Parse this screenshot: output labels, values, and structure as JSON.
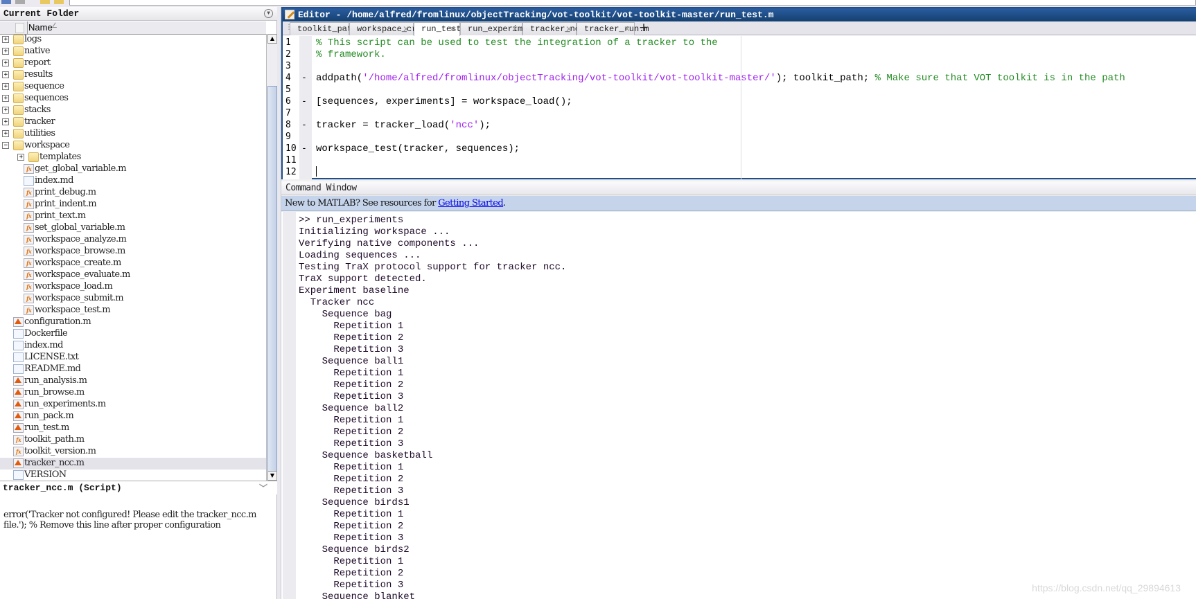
{
  "current_folder": {
    "title": "Current Folder",
    "column_name": "Name",
    "sort_indicator": "∠",
    "items": [
      {
        "name": "logs",
        "type": "folder",
        "level": 0,
        "expand": "+"
      },
      {
        "name": "native",
        "type": "folder",
        "level": 0,
        "expand": "+"
      },
      {
        "name": "report",
        "type": "folder",
        "level": 0,
        "expand": "+"
      },
      {
        "name": "results",
        "type": "folder",
        "level": 0,
        "expand": "+"
      },
      {
        "name": "sequence",
        "type": "folder",
        "level": 0,
        "expand": "+"
      },
      {
        "name": "sequences",
        "type": "folder",
        "level": 0,
        "expand": "+"
      },
      {
        "name": "stacks",
        "type": "folder",
        "level": 0,
        "expand": "+"
      },
      {
        "name": "tracker",
        "type": "folder",
        "level": 0,
        "expand": "+"
      },
      {
        "name": "utilities",
        "type": "folder",
        "level": 0,
        "expand": "+"
      },
      {
        "name": "workspace",
        "type": "folder",
        "level": 0,
        "expand": "−"
      },
      {
        "name": "templates",
        "type": "folder",
        "level": 1,
        "expand": "+"
      },
      {
        "name": "get_global_variable.m",
        "type": "function",
        "level": 1
      },
      {
        "name": "index.md",
        "type": "doc",
        "level": 1
      },
      {
        "name": "print_debug.m",
        "type": "function",
        "level": 1
      },
      {
        "name": "print_indent.m",
        "type": "function",
        "level": 1
      },
      {
        "name": "print_text.m",
        "type": "function",
        "level": 1
      },
      {
        "name": "set_global_variable.m",
        "type": "function",
        "level": 1
      },
      {
        "name": "workspace_analyze.m",
        "type": "function",
        "level": 1
      },
      {
        "name": "workspace_browse.m",
        "type": "function",
        "level": 1
      },
      {
        "name": "workspace_create.m",
        "type": "function",
        "level": 1
      },
      {
        "name": "workspace_evaluate.m",
        "type": "function",
        "level": 1
      },
      {
        "name": "workspace_load.m",
        "type": "function",
        "level": 1
      },
      {
        "name": "workspace_submit.m",
        "type": "function",
        "level": 1
      },
      {
        "name": "workspace_test.m",
        "type": "function",
        "level": 1
      },
      {
        "name": "configuration.m",
        "type": "script",
        "level": 0
      },
      {
        "name": "Dockerfile",
        "type": "doc",
        "level": 0
      },
      {
        "name": "index.md",
        "type": "doc",
        "level": 0
      },
      {
        "name": "LICENSE.txt",
        "type": "doc",
        "level": 0
      },
      {
        "name": "README.md",
        "type": "doc",
        "level": 0
      },
      {
        "name": "run_analysis.m",
        "type": "script",
        "level": 0
      },
      {
        "name": "run_browse.m",
        "type": "script",
        "level": 0
      },
      {
        "name": "run_experiments.m",
        "type": "script",
        "level": 0
      },
      {
        "name": "run_pack.m",
        "type": "script",
        "level": 0
      },
      {
        "name": "run_test.m",
        "type": "script",
        "level": 0
      },
      {
        "name": "toolkit_path.m",
        "type": "function",
        "level": 0
      },
      {
        "name": "toolkit_version.m",
        "type": "function",
        "level": 0
      },
      {
        "name": "tracker_ncc.m",
        "type": "script",
        "level": 0,
        "selected": true
      },
      {
        "name": "VERSION",
        "type": "doc",
        "level": 0
      }
    ]
  },
  "details": {
    "title": "tracker_ncc.m  (Script)",
    "content": "error('Tracker not configured! Please edit the tracker_ncc.m\nfile.'); % Remove this line after proper configuration"
  },
  "editor": {
    "title": "Editor - /home/alfred/fromlinux/objectTracking/vot-toolkit/vot-toolkit-master/run_test.m",
    "tabs": [
      {
        "label": "toolkit_path.m"
      },
      {
        "label": "workspace_create.m"
      },
      {
        "label": "run_test.m",
        "active": true
      },
      {
        "label": "run_experiments.m"
      },
      {
        "label": "tracker_ncc.m"
      },
      {
        "label": "tracker_run.m"
      }
    ],
    "new_tab_label": "+",
    "lines": [
      {
        "n": "1",
        "exec": false,
        "parts": [
          {
            "t": "% This script can be used to test the integration of a tracker to the",
            "c": "cm"
          }
        ]
      },
      {
        "n": "2",
        "exec": false,
        "parts": [
          {
            "t": "% framework.",
            "c": "cm"
          }
        ]
      },
      {
        "n": "3",
        "exec": false,
        "parts": []
      },
      {
        "n": "4",
        "exec": true,
        "parts": [
          {
            "t": "addpath(",
            "c": ""
          },
          {
            "t": "'/home/alfred/fromlinux/objectTracking/vot-toolkit/vot-toolkit-master/'",
            "c": "str"
          },
          {
            "t": "); toolkit_path; ",
            "c": ""
          },
          {
            "t": "% Make sure that VOT toolkit is in the path",
            "c": "cm"
          }
        ]
      },
      {
        "n": "5",
        "exec": false,
        "parts": []
      },
      {
        "n": "6",
        "exec": true,
        "parts": [
          {
            "t": "[sequences, experiments] = workspace_load();",
            "c": ""
          }
        ]
      },
      {
        "n": "7",
        "exec": false,
        "parts": []
      },
      {
        "n": "8",
        "exec": true,
        "parts": [
          {
            "t": "tracker = tracker_load(",
            "c": ""
          },
          {
            "t": "'ncc'",
            "c": "str"
          },
          {
            "t": ");",
            "c": ""
          }
        ]
      },
      {
        "n": "9",
        "exec": false,
        "parts": []
      },
      {
        "n": "10",
        "exec": true,
        "parts": [
          {
            "t": "workspace_test(tracker, sequences);",
            "c": ""
          }
        ]
      },
      {
        "n": "11",
        "exec": false,
        "parts": []
      },
      {
        "n": "12",
        "exec": false,
        "parts": []
      }
    ]
  },
  "command_window": {
    "title": "Command Window",
    "banner_prefix": "New to MATLAB? See resources for ",
    "banner_link": "Getting Started",
    "banner_suffix": ".",
    "output": [
      ">> run_experiments",
      "Initializing workspace ...",
      "Verifying native components ...",
      "Loading sequences ...",
      "Testing TraX protocol support for tracker ncc.",
      "TraX support detected.",
      "Experiment baseline",
      "  Tracker ncc",
      "    Sequence bag",
      "      Repetition 1",
      "      Repetition 2",
      "      Repetition 3",
      "    Sequence ball1",
      "      Repetition 1",
      "      Repetition 2",
      "      Repetition 3",
      "    Sequence ball2",
      "      Repetition 1",
      "      Repetition 2",
      "      Repetition 3",
      "    Sequence basketball",
      "      Repetition 1",
      "      Repetition 2",
      "      Repetition 3",
      "    Sequence birds1",
      "      Repetition 1",
      "      Repetition 2",
      "      Repetition 3",
      "    Sequence birds2",
      "      Repetition 1",
      "      Repetition 2",
      "      Repetition 3",
      "    Sequence blanket"
    ]
  },
  "watermark": "https://blog.csdn.net/qq_29894613",
  "colors": {
    "comment": "#228b22",
    "string": "#a020f0",
    "editor_title": "#1f4f8a",
    "banner": "#c5d4ea"
  }
}
